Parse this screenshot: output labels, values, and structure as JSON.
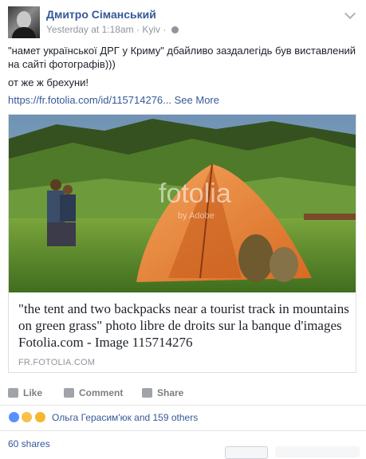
{
  "post": {
    "author": "Дмитро Сіманський",
    "time": "Yesterday at 1:18am",
    "location": "Kyiv",
    "line1": "\"намет української ДРГ у Криму\" дбайливо заздалегідь був виставлений на сайті фотографів)))",
    "line2": "от же ж брехуни!",
    "link_text": "https://fr.fotolia.com/id/115714276...",
    "see_more": "See More"
  },
  "card": {
    "watermark": "fotolia",
    "watermark_sub": "by Adobe",
    "title": "\"the tent and two backpacks near a tourist track in mountains on green grass\" photo libre de droits sur la banque d'images Fotolia.com - Image 115714276",
    "domain": "FR.FOTOLIA.COM"
  },
  "actions": {
    "like": "Like",
    "comment": "Comment",
    "share": "Share"
  },
  "reactions": {
    "text": "Ольга Герасим'юк and 159 others"
  },
  "shares": "60 shares",
  "icons": [
    "chevron-down-icon",
    "globe-icon",
    "like-icon",
    "comment-icon",
    "share-icon",
    "like-reaction-icon",
    "haha-reaction-icon",
    "wow-reaction-icon"
  ]
}
